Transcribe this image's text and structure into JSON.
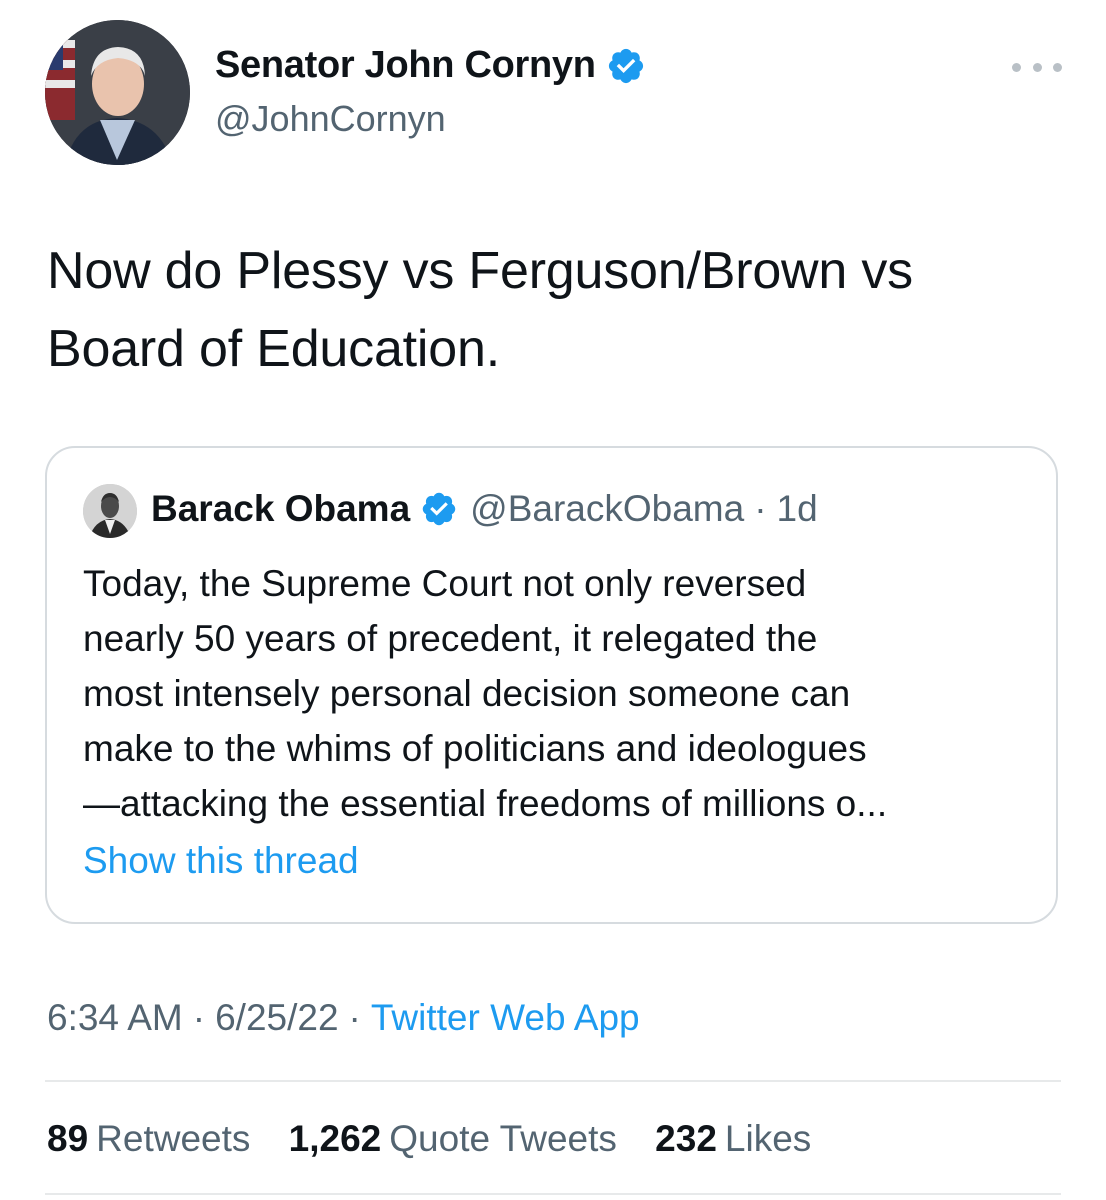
{
  "tweet": {
    "author": {
      "name": "Senator John Cornyn",
      "handle": "@JohnCornyn",
      "verified_icon": "verified-badge-icon"
    },
    "more_icon": "more-horizontal-icon",
    "text": "Now do Plessy vs Ferguson/Brown vs\nBoard of Education.",
    "quoted": {
      "name": "Barack Obama",
      "handle": "@BarackObama",
      "separator": "·",
      "time": "1d",
      "lines": [
        "Today, the Supreme Court not only reversed",
        "nearly 50 years of precedent, it relegated the",
        "most intensely personal decision someone can",
        "make to the whims of politicians and ideologues",
        "—attacking the essential freedoms of millions o..."
      ],
      "show_thread": "Show this thread"
    },
    "meta": {
      "time": "6:34 AM",
      "date": "6/25/22",
      "separator": "·",
      "source": "Twitter Web App"
    },
    "stats": {
      "retweets_count": "89",
      "retweets_label": "Retweets",
      "quotes_count": "1,262",
      "quotes_label": "Quote Tweets",
      "likes_count": "232",
      "likes_label": "Likes"
    }
  },
  "colors": {
    "link": "#1d9bf0",
    "secondary_text": "#536471",
    "primary_text": "#0f1419",
    "border": "#d6dbdf"
  }
}
